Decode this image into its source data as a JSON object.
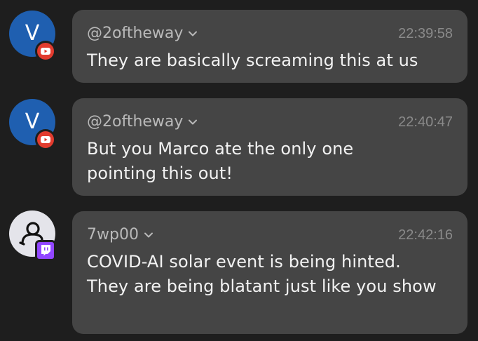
{
  "messages": [
    {
      "avatar": {
        "type": "letter",
        "letter": "V",
        "color": "#1f5fb0"
      },
      "platform": "youtube",
      "username": "@2oftheway",
      "time": "22:39:58",
      "text": "They are basically screaming this at us"
    },
    {
      "avatar": {
        "type": "letter",
        "letter": "V",
        "color": "#1f5fb0"
      },
      "platform": "youtube",
      "username": "@2oftheway",
      "time": "22:40:47",
      "text": "But you Marco ate the only one pointing this out!"
    },
    {
      "avatar": {
        "type": "default-user-icon"
      },
      "platform": "twitch",
      "username": "7wp00",
      "time": "22:42:16",
      "text": "COVID-AI solar event is being hinted. They are being blatant just like you show"
    }
  ],
  "colors": {
    "background": "#1e1e1e",
    "bubble": "#454545",
    "youtube": "#e23b2e",
    "twitch": "#9146ff"
  },
  "icons": {
    "youtube_badge": "youtube-logo-icon",
    "twitch_badge": "twitch-logo-icon",
    "username_menu": "chevron-down-icon",
    "default_avatar": "user-silhouette-icon"
  }
}
